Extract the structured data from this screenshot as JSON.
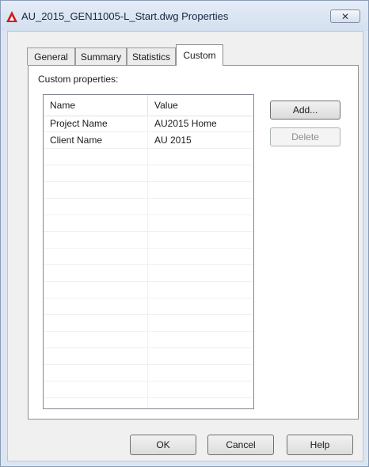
{
  "window": {
    "title": "AU_2015_GEN11005-L_Start.dwg Properties",
    "close_glyph": "✕",
    "accent_color": "#d01c1c"
  },
  "tabs": [
    {
      "label": "General",
      "active": false
    },
    {
      "label": "Summary",
      "active": false
    },
    {
      "label": "Statistics",
      "active": false
    },
    {
      "label": "Custom",
      "active": true
    }
  ],
  "custom": {
    "group_label": "Custom properties:",
    "columns": {
      "name": "Name",
      "value": "Value"
    },
    "rows": [
      {
        "name": "Project Name",
        "value": "AU2015 Home"
      },
      {
        "name": "Client Name",
        "value": "AU 2015"
      }
    ],
    "add_label": "Add...",
    "delete_label": "Delete"
  },
  "footer": {
    "ok_label": "OK",
    "cancel_label": "Cancel",
    "help_label": "Help"
  }
}
